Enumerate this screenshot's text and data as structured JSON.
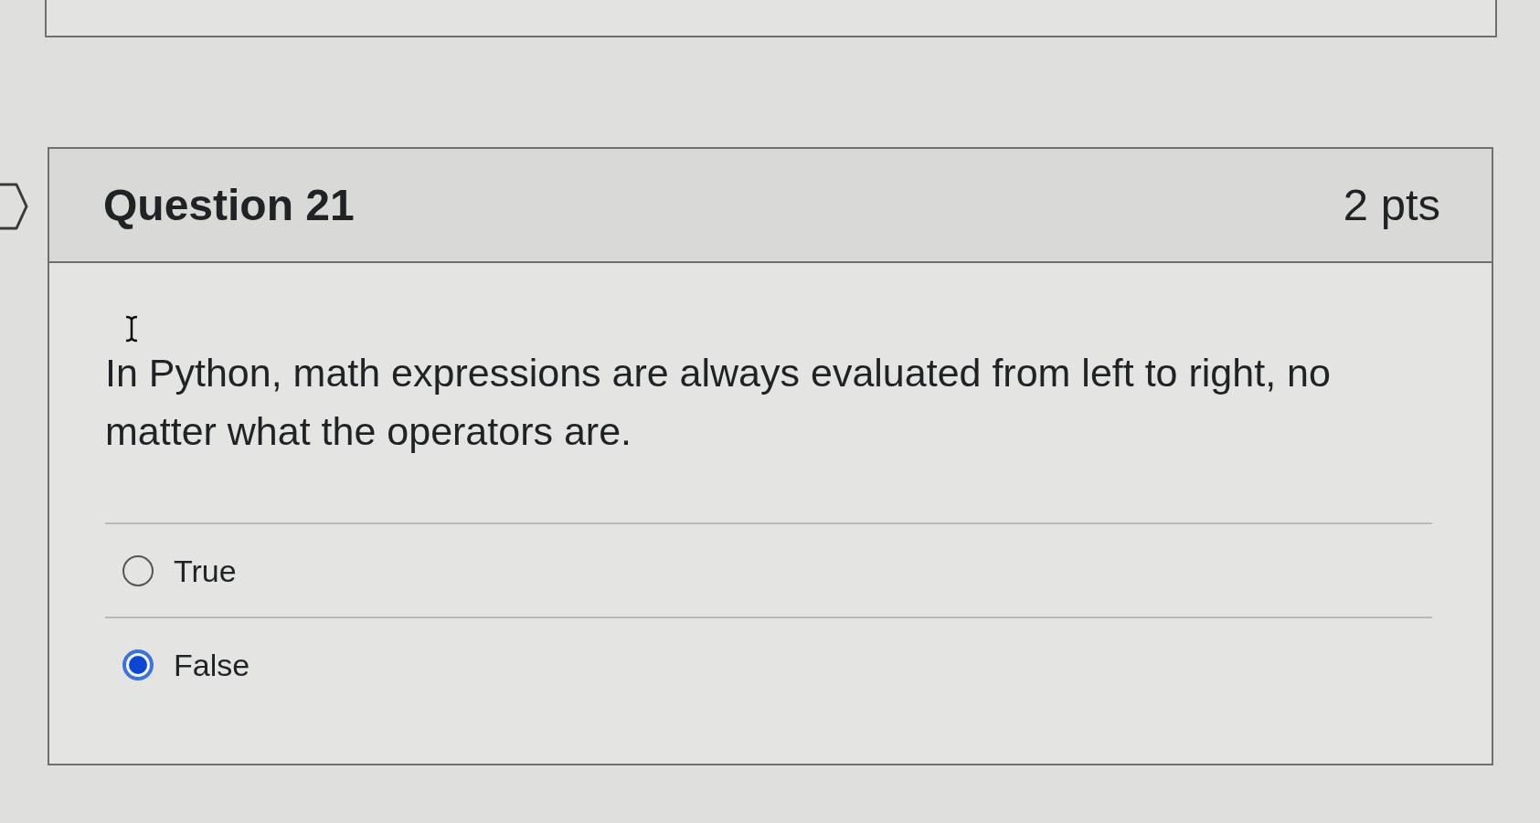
{
  "question": {
    "title": "Question 21",
    "points": "2 pts",
    "text": "In Python, math expressions are always evaluated from left to right, no matter what the operators are.",
    "options": [
      {
        "label": "True",
        "selected": false
      },
      {
        "label": "False",
        "selected": true
      }
    ]
  }
}
